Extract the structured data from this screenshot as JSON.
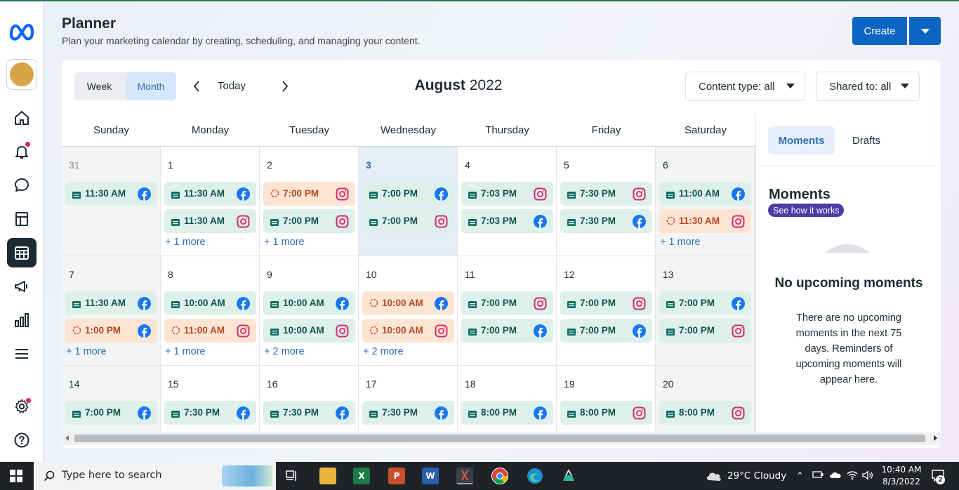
{
  "header": {
    "title": "Planner",
    "subtitle": "Plan your marketing calendar by creating, scheduling, and managing your content.",
    "create_label": "Create"
  },
  "toolbar": {
    "view_week": "Week",
    "view_month": "Month",
    "selected_view": "Month",
    "today_label": "Today",
    "month_name": "August",
    "year": "2022",
    "content_type_label": "Content type: all",
    "shared_to_label": "Shared to: all"
  },
  "calendar": {
    "day_names": [
      "Sunday",
      "Monday",
      "Tuesday",
      "Wednesday",
      "Thursday",
      "Friday",
      "Saturday"
    ],
    "weeks": [
      [
        {
          "day": "31",
          "other": true,
          "events": [
            {
              "time": "11:30 AM",
              "status": "scheduled",
              "network": "facebook"
            }
          ],
          "more": ""
        },
        {
          "day": "1",
          "events": [
            {
              "time": "11:30 AM",
              "status": "scheduled",
              "network": "facebook"
            },
            {
              "time": "11:30 AM",
              "status": "scheduled",
              "network": "instagram"
            }
          ],
          "more": "+ 1 more"
        },
        {
          "day": "2",
          "events": [
            {
              "time": "7:00 PM",
              "status": "pending",
              "network": "instagram"
            },
            {
              "time": "7:00 PM",
              "status": "scheduled",
              "network": "instagram"
            }
          ],
          "more": "+ 1 more"
        },
        {
          "day": "3",
          "today": true,
          "events": [
            {
              "time": "7:00 PM",
              "status": "scheduled",
              "network": "facebook"
            },
            {
              "time": "7:00 PM",
              "status": "scheduled",
              "network": "instagram"
            }
          ],
          "more": ""
        },
        {
          "day": "4",
          "events": [
            {
              "time": "7:03 PM",
              "status": "scheduled",
              "network": "instagram"
            },
            {
              "time": "7:03 PM",
              "status": "scheduled",
              "network": "facebook"
            }
          ],
          "more": ""
        },
        {
          "day": "5",
          "events": [
            {
              "time": "7:30 PM",
              "status": "scheduled",
              "network": "instagram"
            },
            {
              "time": "7:30 PM",
              "status": "scheduled",
              "network": "facebook"
            }
          ],
          "more": ""
        },
        {
          "day": "6",
          "other": true,
          "events": [
            {
              "time": "11:00 AM",
              "status": "scheduled",
              "network": "facebook"
            },
            {
              "time": "11:30 AM",
              "status": "pending",
              "network": "instagram"
            }
          ],
          "more": "+ 1 more"
        }
      ],
      [
        {
          "day": "7",
          "other": true,
          "events": [
            {
              "time": "11:30 AM",
              "status": "scheduled",
              "network": "facebook"
            },
            {
              "time": "1:00 PM",
              "status": "pending",
              "network": "facebook"
            }
          ],
          "more": "+ 1 more"
        },
        {
          "day": "8",
          "events": [
            {
              "time": "10:00 AM",
              "status": "scheduled",
              "network": "facebook"
            },
            {
              "time": "11:00 AM",
              "status": "pending",
              "network": "instagram"
            }
          ],
          "more": "+ 1 more"
        },
        {
          "day": "9",
          "events": [
            {
              "time": "10:00 AM",
              "status": "scheduled",
              "network": "facebook"
            },
            {
              "time": "10:00 AM",
              "status": "scheduled",
              "network": "instagram"
            }
          ],
          "more": "+ 2 more"
        },
        {
          "day": "10",
          "events": [
            {
              "time": "10:00 AM",
              "status": "pending",
              "network": "facebook"
            },
            {
              "time": "10:00 AM",
              "status": "pending",
              "network": "instagram"
            }
          ],
          "more": "+ 2 more"
        },
        {
          "day": "11",
          "events": [
            {
              "time": "7:00 PM",
              "status": "scheduled",
              "network": "instagram"
            },
            {
              "time": "7:00 PM",
              "status": "scheduled",
              "network": "facebook"
            }
          ],
          "more": ""
        },
        {
          "day": "12",
          "events": [
            {
              "time": "7:00 PM",
              "status": "scheduled",
              "network": "instagram"
            },
            {
              "time": "7:00 PM",
              "status": "scheduled",
              "network": "facebook"
            }
          ],
          "more": ""
        },
        {
          "day": "13",
          "other": true,
          "events": [
            {
              "time": "7:00 PM",
              "status": "scheduled",
              "network": "facebook"
            },
            {
              "time": "7:00 PM",
              "status": "scheduled",
              "network": "instagram"
            }
          ],
          "more": ""
        }
      ],
      [
        {
          "day": "14",
          "other": true,
          "events": [
            {
              "time": "7:00 PM",
              "status": "scheduled",
              "network": "facebook"
            }
          ],
          "more": ""
        },
        {
          "day": "15",
          "events": [
            {
              "time": "7:30 PM",
              "status": "scheduled",
              "network": "facebook"
            }
          ],
          "more": ""
        },
        {
          "day": "16",
          "events": [
            {
              "time": "7:30 PM",
              "status": "scheduled",
              "network": "facebook"
            }
          ],
          "more": ""
        },
        {
          "day": "17",
          "events": [
            {
              "time": "7:30 PM",
              "status": "scheduled",
              "network": "facebook"
            }
          ],
          "more": ""
        },
        {
          "day": "18",
          "events": [
            {
              "time": "8:00 PM",
              "status": "scheduled",
              "network": "facebook"
            }
          ],
          "more": ""
        },
        {
          "day": "19",
          "events": [
            {
              "time": "8:00 PM",
              "status": "scheduled",
              "network": "instagram"
            }
          ],
          "more": ""
        },
        {
          "day": "20",
          "other": true,
          "events": [
            {
              "time": "8:00 PM",
              "status": "scheduled",
              "network": "instagram"
            }
          ],
          "more": ""
        }
      ]
    ]
  },
  "side_panel": {
    "tab_moments": "Moments",
    "tab_drafts": "Drafts",
    "title": "Moments",
    "how_link": "See how it works",
    "empty_title": "No upcoming moments",
    "empty_text": "There are no upcoming moments in the next 75 days. Reminders of upcoming moments will appear here."
  },
  "taskbar": {
    "search_placeholder": "Type here to search",
    "weather": "29°C  Cloudy",
    "time": "10:40 AM",
    "date": "8/3/2022",
    "notification_count": "2",
    "apps": [
      "task-view",
      "file-explorer",
      "excel",
      "powerpoint",
      "word",
      "snipping-tool",
      "chrome",
      "edge",
      "store-app"
    ]
  },
  "colors": {
    "accent": "#0a66c2",
    "scheduled_bg": "#def0ea",
    "pending_bg": "#fde5d4",
    "today_cell": "#e3eef7",
    "facebook": "#1877f2",
    "instagram": "#d62976"
  }
}
